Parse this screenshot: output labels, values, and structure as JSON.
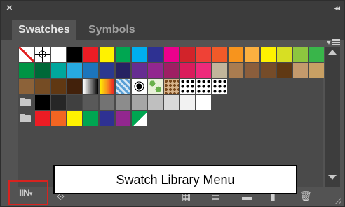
{
  "panel": {
    "close_glyph": "×",
    "collapse_glyph": "◂◂",
    "tabs": [
      {
        "label": "Swatches"
      },
      {
        "label": "Symbols"
      }
    ],
    "panel_menu_glyph": "▾"
  },
  "swatch_rows": [
    [
      "none",
      "registration",
      "#ffffff",
      "#000000",
      "#ed1c24",
      "#fff200",
      "#00a651",
      "#00aeef",
      "#2e3192",
      "#ec008c",
      "#d2232a",
      "#ef4136",
      "#f15a29",
      "#f7941d",
      "#fbb040",
      "#fff200",
      "#d7df23",
      "#8dc63f",
      "#39b54a"
    ],
    [
      "#009444",
      "#006838",
      "#00a79d",
      "#27aae1",
      "#1c75bc",
      "#2b3990",
      "#262262",
      "#662d91",
      "#92278f",
      "#9e1f63",
      "#da1c5c",
      "#ee2a7b",
      "#c2b59b",
      "#a97c50",
      "#8b5e3c",
      "#754c29",
      "#603913",
      "#c49a6c",
      "#c8a064"
    ],
    [
      "#8c6239",
      "#754c24",
      "#603813",
      "#42210b",
      "grad-white",
      "grad-yellow",
      "pattern-check",
      "pattern-circle",
      "pattern-leaf",
      "pattern-brown",
      "pattern-dots",
      "pattern-dots",
      "pattern-dots"
    ],
    [
      "folder",
      "#000000",
      "#262626",
      "#404040",
      "#595959",
      "#737373",
      "#8c8c8c",
      "#a6a6a6",
      "#bfbfbf",
      "#d9d9d9",
      "#f2f2f2",
      "#ffffff"
    ],
    [
      "folder",
      "#ed1c24",
      "#f26522",
      "#fff200",
      "#00a651",
      "#2e3192",
      "#92278f",
      "process-corner"
    ]
  ],
  "bottom": {
    "library_glyph": "IIN",
    "library_caret": "▾",
    "tooltip": "Swatch Library Menu",
    "icons": {
      "kind": "⟐",
      "grid": "▦",
      "options": "▤",
      "new_group": "▬",
      "new": "◧",
      "delete": "🗑"
    }
  }
}
